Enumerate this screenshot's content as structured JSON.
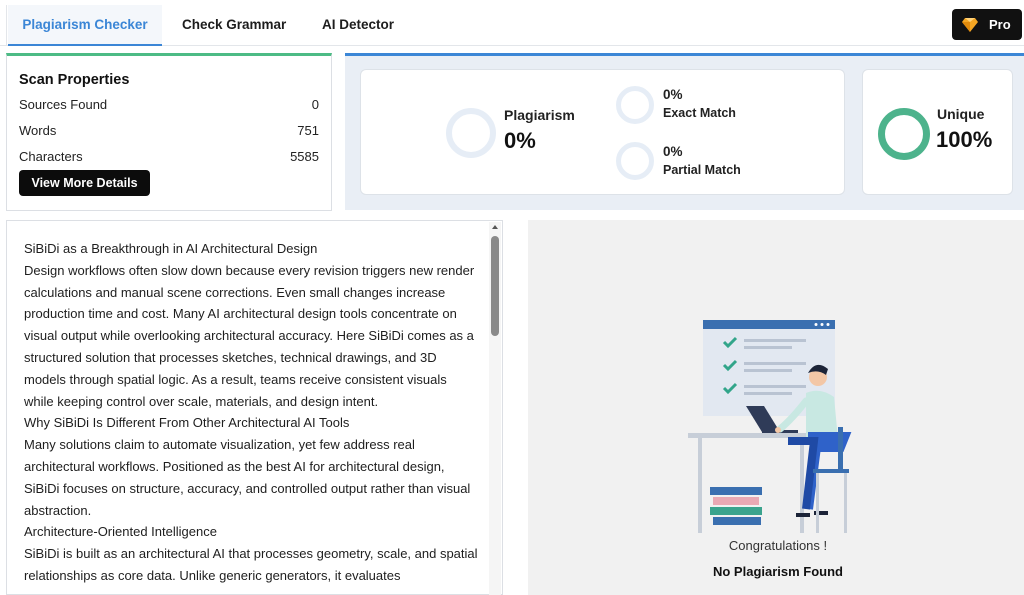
{
  "tabs": {
    "plagiarism": "Plagiarism Checker",
    "grammar": "Check Grammar",
    "ai_detector": "AI Detector",
    "pro": "Pro"
  },
  "scan": {
    "title": "Scan Properties",
    "rows": [
      {
        "label": "Sources Found",
        "value": "0"
      },
      {
        "label": "Words",
        "value": "751"
      },
      {
        "label": "Characters",
        "value": "5585"
      }
    ],
    "details_button": "View More Details"
  },
  "results": {
    "plagiarism_label": "Plagiarism",
    "plagiarism_value": "0%",
    "exact_value": "0%",
    "exact_label": "Exact Match",
    "partial_value": "0%",
    "partial_label": "Partial Match",
    "unique_label": "Unique",
    "unique_value": "100%"
  },
  "document": {
    "paragraphs": [
      "SiBiDi as a Breakthrough in AI Architectural Design",
      "Design workflows often slow down because every revision triggers new render calculations and manual scene corrections. Even small changes increase production time and cost. Many AI architectural design tools concentrate on visual output while overlooking architectural accuracy. Here SiBiDi comes as a structured solution that processes sketches, technical drawings, and 3D models through spatial logic. As a result, teams receive consistent visuals while keeping control over scale, materials, and design intent.",
      "Why SiBiDi Is Different From Other Architectural AI Tools",
      "Many solutions claim to automate visualization, yet few address real architectural workflows. Positioned as the best AI for architectural design, SiBiDi focuses on structure, accuracy, and controlled output rather than visual abstraction.",
      "Architecture-Oriented Intelligence",
      "SiBiDi is built as an architectural AI that processes geometry, scale, and spatial relationships as core data. Unlike generic generators, it evaluates"
    ]
  },
  "outcome": {
    "congrats": "Congratulations !",
    "message": "No Plagiarism Found"
  },
  "colors": {
    "accent_blue": "#3b86d6",
    "accent_green": "#4db38c",
    "ring_empty": "#e6edf6"
  },
  "icons": [
    "gem-icon",
    "checklist-icon",
    "person-laptop-illustration"
  ]
}
